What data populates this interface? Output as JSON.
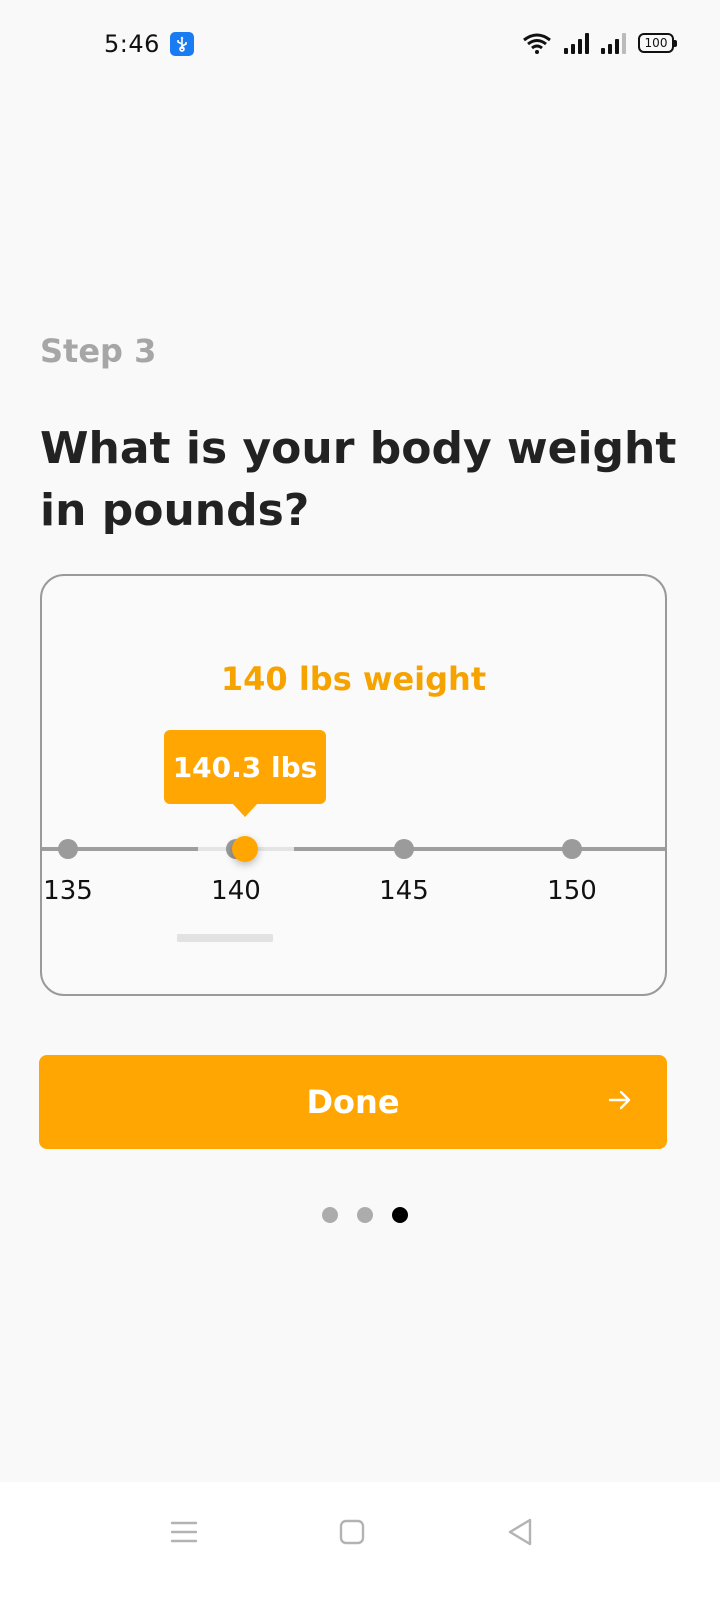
{
  "status_bar": {
    "time": "5:46",
    "battery": "100",
    "icons": [
      "usb-icon",
      "wifi-icon",
      "signal-icon",
      "signal-icon",
      "battery-icon"
    ]
  },
  "onboarding": {
    "step_label": "Step 3",
    "question": "What is your body weight in pounds?",
    "weight_readout": "140 lbs weight",
    "slider": {
      "tooltip_value": "140.3 lbs",
      "value": 140.3,
      "ticks": [
        "135",
        "140",
        "145",
        "150"
      ]
    },
    "done_label": "Done",
    "done_icon": "arrow-right-icon",
    "page_indicator": {
      "total": 3,
      "active": 3
    }
  },
  "colors": {
    "accent": "#ffa602",
    "readout_text": "#f6a300",
    "step_label": "#a6a6a6",
    "track": "#9e9e9e"
  },
  "nav_bar": {
    "icons": [
      "menu-icon",
      "home-icon",
      "back-icon"
    ]
  }
}
